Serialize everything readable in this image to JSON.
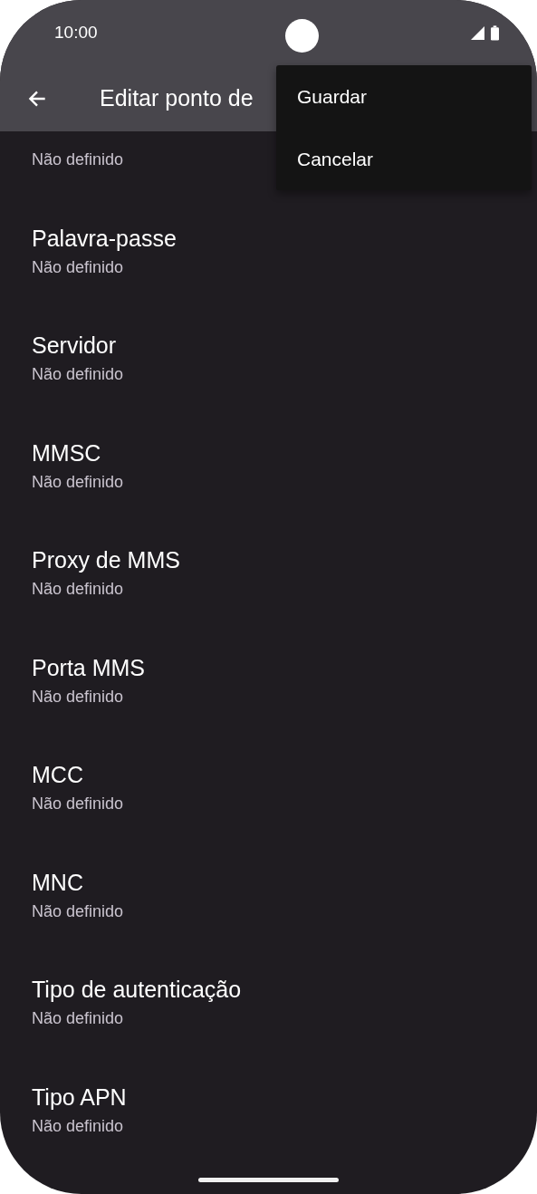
{
  "status_bar": {
    "time": "10:00"
  },
  "app_bar": {
    "title": "Editar ponto de"
  },
  "settings": [
    {
      "value": "Não definido"
    },
    {
      "title": "Palavra-passe",
      "value": "Não definido"
    },
    {
      "title": "Servidor",
      "value": "Não definido"
    },
    {
      "title": "MMSC",
      "value": "Não definido"
    },
    {
      "title": "Proxy de MMS",
      "value": "Não definido"
    },
    {
      "title": "Porta MMS",
      "value": "Não definido"
    },
    {
      "title": "MCC",
      "value": "Não definido"
    },
    {
      "title": "MNC",
      "value": "Não definido"
    },
    {
      "title": "Tipo de autenticação",
      "value": "Não definido"
    },
    {
      "title": "Tipo APN",
      "value": "Não definido"
    }
  ],
  "menu": [
    "Guardar",
    "Cancelar"
  ]
}
